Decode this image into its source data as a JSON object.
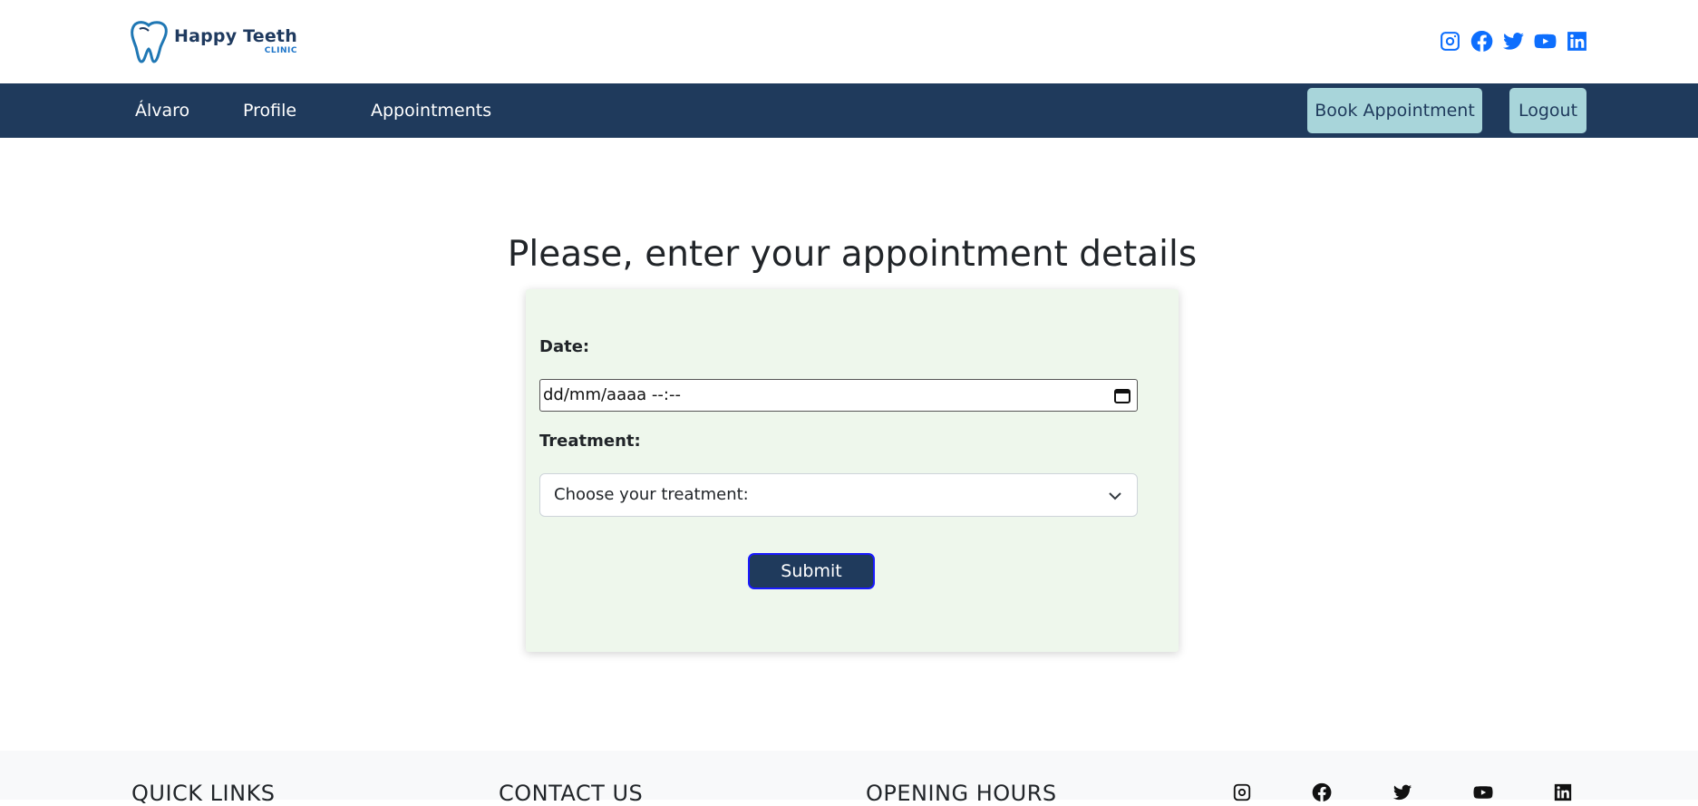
{
  "brand": {
    "name": "Happy Teeth",
    "subtitle": "CLINIC",
    "colors": {
      "primary": "#1f3a5c",
      "accent": "#a8d5da",
      "social": "#0d6efd",
      "form_bg": "#eef7ec"
    }
  },
  "top_social": [
    "instagram-icon",
    "facebook-icon",
    "twitter-icon",
    "youtube-icon",
    "linkedin-icon"
  ],
  "nav": {
    "user": "Álvaro",
    "profile": "Profile",
    "appointments": "Appointments",
    "book": "Book Appointment",
    "logout": "Logout"
  },
  "main": {
    "title": "Please, enter your appointment details"
  },
  "form": {
    "date_label": "Date:",
    "date_value": "dd/mm/aaaa --:--",
    "treatment_label": "Treatment:",
    "treatment_selected": "Choose your treatment:",
    "submit": "Submit"
  },
  "footer": {
    "quick_links": "QUICK LINKS",
    "contact": "CONTACT US",
    "hours": "OPENING HOURS",
    "social": [
      "instagram-icon",
      "facebook-icon",
      "twitter-icon",
      "youtube-icon",
      "linkedin-icon"
    ]
  }
}
